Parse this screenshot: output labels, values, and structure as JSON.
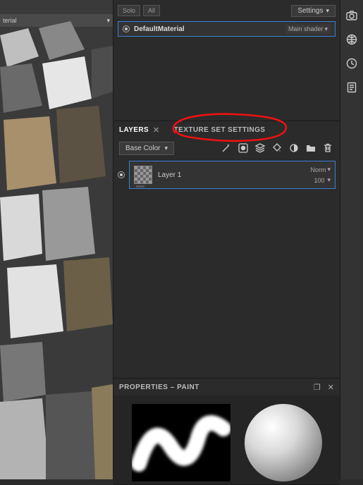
{
  "viewport": {
    "dropdown_label": "terial"
  },
  "materials": {
    "solo_label": "Solo",
    "all_label": "All",
    "settings_label": "Settings",
    "items": [
      {
        "name": "DefaultMaterial",
        "shader": "Main shader"
      }
    ]
  },
  "tabs": {
    "layers": "LAYERS",
    "texture_set": "TEXTURE SET SETTINGS"
  },
  "layers": {
    "channel": "Base Color",
    "items": [
      {
        "name": "Layer 1",
        "blend": "Norm",
        "opacity": "100"
      }
    ]
  },
  "properties": {
    "title": "PROPERTIES – PAINT"
  },
  "icons": {
    "camera": "camera-icon",
    "globe": "globe-icon",
    "history": "history-icon",
    "notes": "notes-icon"
  }
}
